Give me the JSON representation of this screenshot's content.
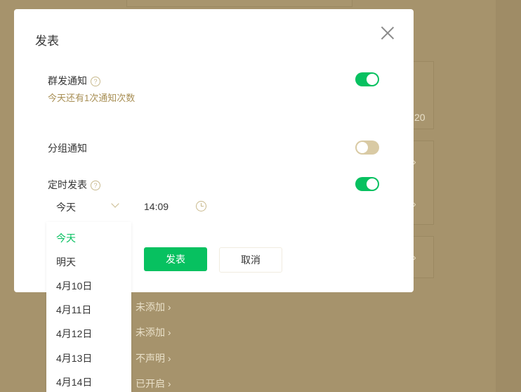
{
  "background": {
    "items": [
      {
        "text": "20"
      },
      {
        "text": "未添加"
      },
      {
        "text": "未添加"
      },
      {
        "text": "不声明"
      },
      {
        "text": "已开启"
      }
    ]
  },
  "dialog": {
    "title": "发表",
    "close_icon": "close-icon",
    "mass_notice": {
      "label": "群发通知",
      "help": "?",
      "sub": "今天还有1次通知次数",
      "on": true
    },
    "group_notice": {
      "label": "分组通知",
      "on": false
    },
    "scheduled": {
      "label": "定时发表",
      "help": "?",
      "on": true
    },
    "date_value": "今天",
    "time_value": "14:09",
    "publish_button": "发表",
    "cancel_button": "取消"
  },
  "date_options": [
    "今天",
    "明天",
    "4月10日",
    "4月11日",
    "4月12日",
    "4月13日",
    "4月14日"
  ],
  "colors": {
    "accent": "#07c160",
    "toggle_off": "#d9caa4",
    "hint": "#a88f55"
  }
}
